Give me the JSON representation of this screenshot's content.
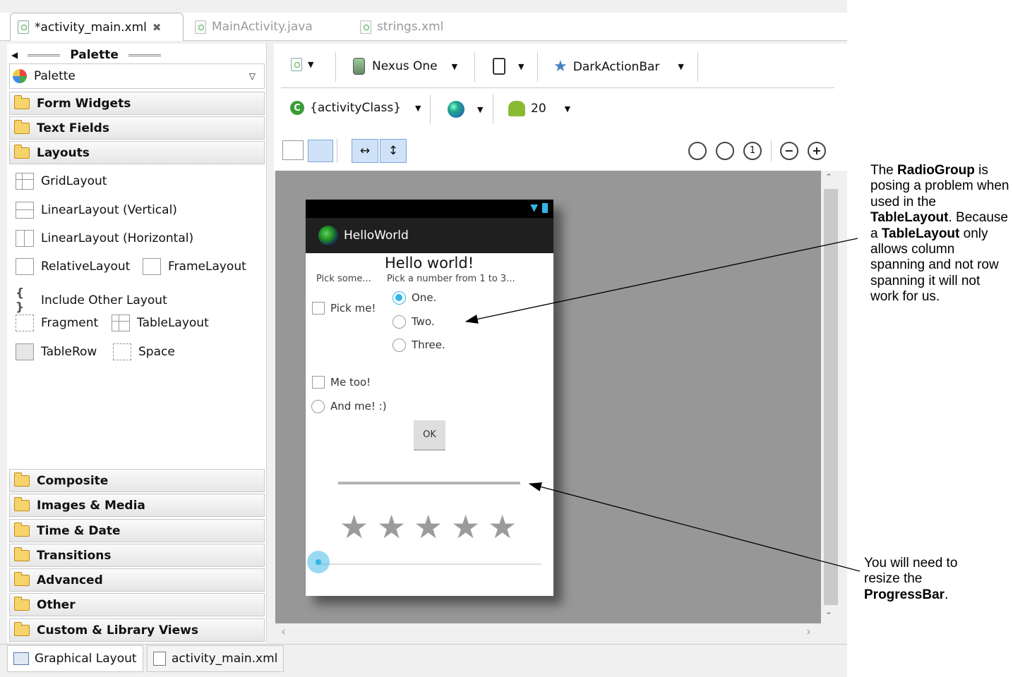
{
  "file_tabs": [
    {
      "label": "*activity_main.xml",
      "active": true
    },
    {
      "label": "MainActivity.java",
      "active": false
    },
    {
      "label": "strings.xml",
      "active": false
    }
  ],
  "palette": {
    "title": "Palette",
    "dropdown_label": "Palette",
    "categories_top": [
      "Form Widgets",
      "Text Fields",
      "Layouts"
    ],
    "layout_items": {
      "grid": "GridLayout",
      "linear_v": "LinearLayout (Vertical)",
      "linear_h": "LinearLayout (Horizontal)",
      "relative": "RelativeLayout",
      "frame": "FrameLayout",
      "include": "Include Other Layout",
      "fragment": "Fragment",
      "table": "TableLayout",
      "tablerow": "TableRow",
      "space": "Space"
    },
    "categories_bottom": [
      "Composite",
      "Images & Media",
      "Time & Date",
      "Transitions",
      "Advanced",
      "Other",
      "Custom & Library Views"
    ]
  },
  "toolbar": {
    "device": "Nexus One",
    "theme": "DarkActionBar",
    "activity": "{activityClass}",
    "api_level": "20"
  },
  "device_screen": {
    "app_title": "HelloWorld",
    "heading": "Hello world!",
    "pick_some": "Pick some...",
    "pick_number": "Pick a number from 1 to 3...",
    "checkbox_pick_me": "Pick me!",
    "radio_one": "One.",
    "radio_two": "Two.",
    "radio_three": "Three.",
    "checkbox_me_too": "Me too!",
    "radio_and_me": "And me! :)",
    "ok_button": "OK",
    "rating_stars": 5
  },
  "bottom_tabs": {
    "graphical": "Graphical Layout",
    "xml": "activity_main.xml"
  },
  "callout1": {
    "t1": "The ",
    "b1": "RadioGroup",
    "t2": " is posing a problem when used in the ",
    "b2": "TableLayout",
    "t3": ". Because a ",
    "b3": "TableLayout",
    "t4": " only allows column spanning and not row spanning it will not work for us."
  },
  "callout2": {
    "t1": "You will need to resize the ",
    "b1": "ProgressBar",
    "t2": "."
  },
  "colors": {
    "accent": "#33b5e5",
    "canvas": "#979797",
    "action_bar": "#1f1f1f",
    "folder": "#f7d46b"
  }
}
